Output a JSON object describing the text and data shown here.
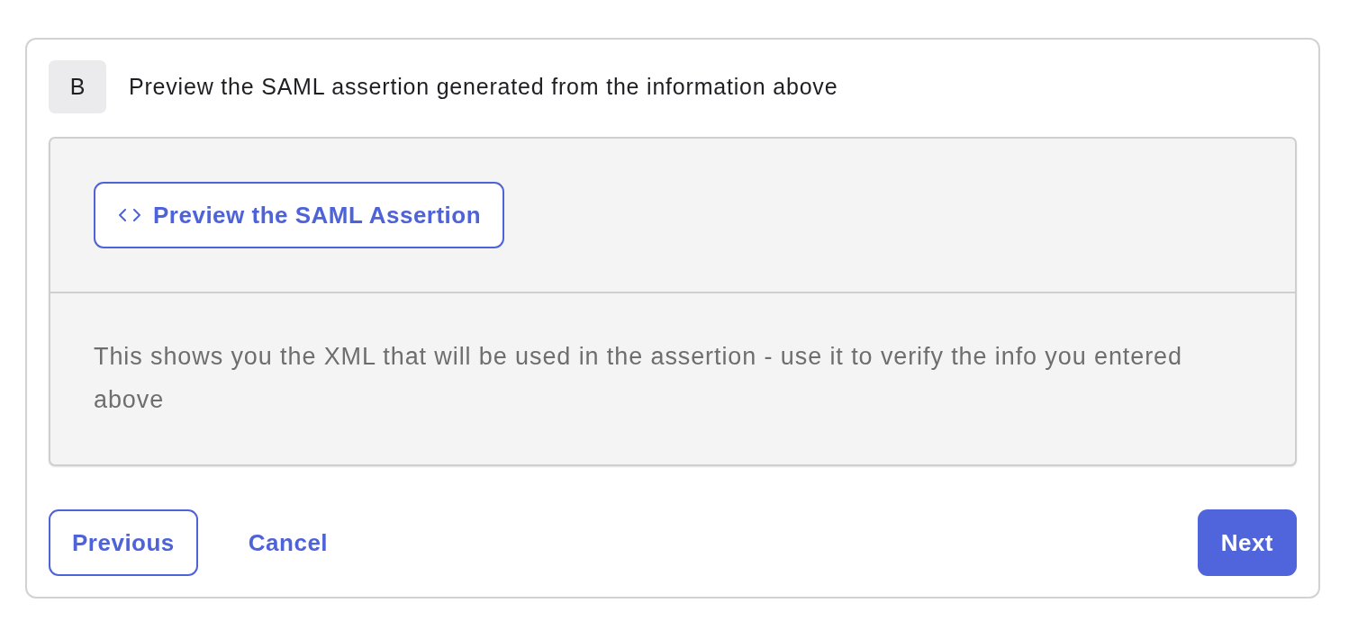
{
  "step": {
    "badge": "B",
    "title": "Preview the SAML assertion generated from the information above"
  },
  "preview": {
    "button_label": "Preview the SAML Assertion",
    "description": "This shows you the XML that will be used in the assertion - use it to verify the info you entered above"
  },
  "footer": {
    "buttons": [
      {
        "label": "Previous",
        "kind": "outline"
      },
      {
        "label": "Cancel",
        "kind": "link"
      },
      {
        "label": "Next",
        "kind": "primary"
      }
    ]
  }
}
